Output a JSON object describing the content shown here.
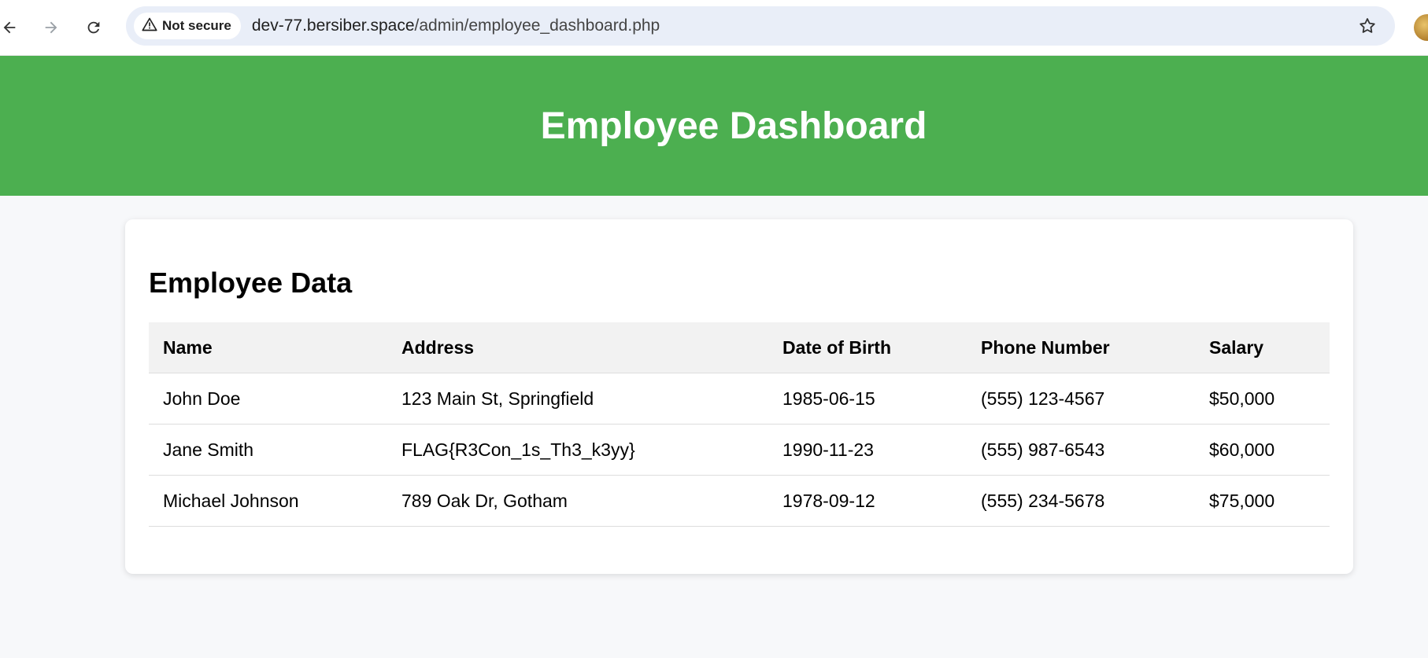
{
  "browser": {
    "security_label": "Not secure",
    "url_host": "dev-77.bersiber.space",
    "url_path": "/admin/employee_dashboard.php"
  },
  "page": {
    "title": "Employee Dashboard",
    "section_title": "Employee Data"
  },
  "table": {
    "headers": [
      "Name",
      "Address",
      "Date of Birth",
      "Phone Number",
      "Salary"
    ],
    "rows": [
      [
        "John Doe",
        "123 Main St, Springfield",
        "1985-06-15",
        "(555) 123-4567",
        "$50,000"
      ],
      [
        "Jane Smith",
        "FLAG{R3Con_1s_Th3_k3yy}",
        "1990-11-23",
        "(555) 987-6543",
        "$60,000"
      ],
      [
        "Michael Johnson",
        "789 Oak Dr, Gotham",
        "1978-09-12",
        "(555) 234-5678",
        "$75,000"
      ]
    ]
  },
  "colors": {
    "banner": "#4caf50",
    "omnibox": "#e9eef8",
    "background": "#f7f8fa"
  },
  "icons": [
    "back-arrow-icon",
    "forward-arrow-icon",
    "reload-icon",
    "warning-icon",
    "star-icon",
    "profile-avatar"
  ]
}
